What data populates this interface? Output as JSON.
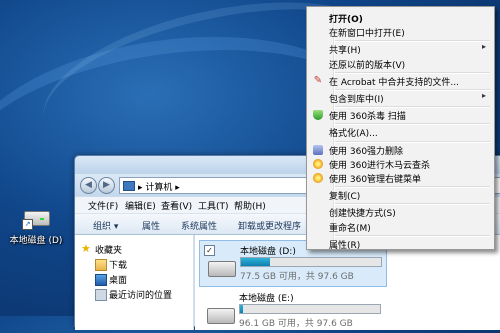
{
  "desktop": {
    "drive_icon_label": "本地磁盘 (D)"
  },
  "explorer": {
    "address": {
      "crumb": "计算机",
      "back_glyph": "◀",
      "forward_glyph": "▶",
      "sep": "▸"
    },
    "menubar": [
      "文件(F)",
      "编辑(E)",
      "查看(V)",
      "工具(T)",
      "帮助(H)"
    ],
    "toolbar": [
      "组织 ▾",
      "属性",
      "系统属性",
      "卸载或更改程序",
      "映射"
    ],
    "nav": [
      {
        "label": "收藏夹",
        "icon": "star-icon"
      },
      {
        "label": "下载",
        "icon": "folder-icon"
      },
      {
        "label": "桌面",
        "icon": "desktop-icon"
      },
      {
        "label": "最近访问的位置",
        "icon": "recent-places-icon"
      }
    ],
    "drives": [
      {
        "name": "本地磁盘 (D:)",
        "free_text": "77.5 GB 可用，共 97.6 GB",
        "used_fraction": 0.21,
        "selected": true,
        "checked": "✓"
      },
      {
        "name": "本地磁盘 (E:)",
        "free_text": "96.1 GB 可用，共 97.6 GB",
        "used_fraction": 0.02,
        "selected": false,
        "checked": ""
      }
    ]
  },
  "context_menu": {
    "items": [
      {
        "label": "打开(O)",
        "bold": true,
        "icon": ""
      },
      {
        "label": "在新窗口中打开(E)",
        "icon": ""
      },
      {
        "sep": true
      },
      {
        "label": "共享(H)",
        "submenu": true,
        "icon": ""
      },
      {
        "label": "还原以前的版本(V)",
        "icon": ""
      },
      {
        "sep": true
      },
      {
        "label": "在 Acrobat 中合并支持的文件...",
        "icon": "acrobat-icon"
      },
      {
        "sep": true
      },
      {
        "label": "包含到库中(I)",
        "submenu": true,
        "icon": ""
      },
      {
        "sep": true
      },
      {
        "label": "使用 360杀毒 扫描",
        "icon": "360-antivirus-icon"
      },
      {
        "sep": true
      },
      {
        "label": "格式化(A)...",
        "icon": ""
      },
      {
        "sep": true
      },
      {
        "label": "使用 360强力删除",
        "icon": "shred-icon"
      },
      {
        "label": "使用 360进行木马云查杀",
        "icon": "360-trojan-scan-icon"
      },
      {
        "label": "使用 360管理右键菜单",
        "icon": "360-menu-manager-icon"
      },
      {
        "sep": true
      },
      {
        "label": "复制(C)",
        "icon": ""
      },
      {
        "sep": true
      },
      {
        "label": "创建快捷方式(S)",
        "icon": ""
      },
      {
        "label": "重命名(M)",
        "icon": ""
      },
      {
        "sep": true
      },
      {
        "label": "属性(R)",
        "icon": ""
      }
    ],
    "submenu_glyph": "▸"
  }
}
